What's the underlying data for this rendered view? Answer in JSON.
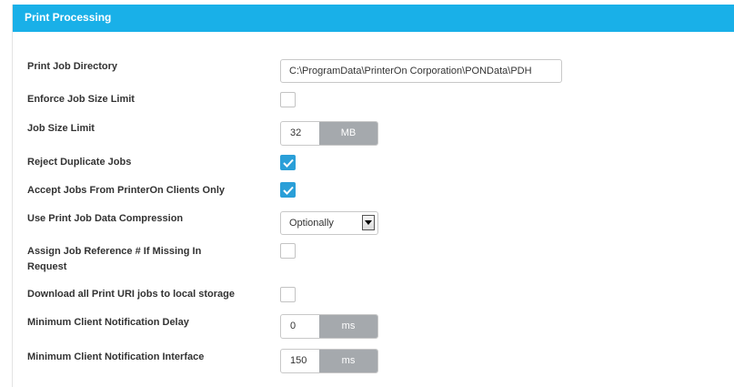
{
  "panel": {
    "title": "Print Processing"
  },
  "fields": {
    "print_job_directory": {
      "label": "Print Job Directory",
      "value": "C:\\ProgramData\\PrinterOn Corporation\\PONData\\PDH"
    },
    "enforce_job_size_limit": {
      "label": "Enforce Job Size Limit",
      "checked": false
    },
    "job_size_limit": {
      "label": "Job Size Limit",
      "value": "32",
      "unit": "MB"
    },
    "reject_duplicate_jobs": {
      "label": "Reject Duplicate Jobs",
      "checked": true
    },
    "accept_printeron_only": {
      "label": "Accept Jobs From PrinterOn Clients Only",
      "checked": true
    },
    "data_compression": {
      "label": "Use Print Job Data Compression",
      "selected": "Optionally"
    },
    "assign_job_reference": {
      "label": "Assign Job Reference # If Missing In Request",
      "checked": false
    },
    "download_print_uri": {
      "label": "Download all Print URI jobs to local storage",
      "checked": false
    },
    "min_notification_delay": {
      "label": "Minimum Client Notification Delay",
      "value": "0",
      "unit": "ms"
    },
    "min_notification_interface": {
      "label": "Minimum Client Notification Interface",
      "value": "150",
      "unit": "ms"
    }
  },
  "colors": {
    "header": "#19b0e8",
    "checkbox_checked": "#2a9fd8",
    "unit_bg": "#a5a9ad"
  },
  "icons": {
    "checkmark": "checkmark-icon",
    "dropdown": "chevron-down-icon"
  }
}
